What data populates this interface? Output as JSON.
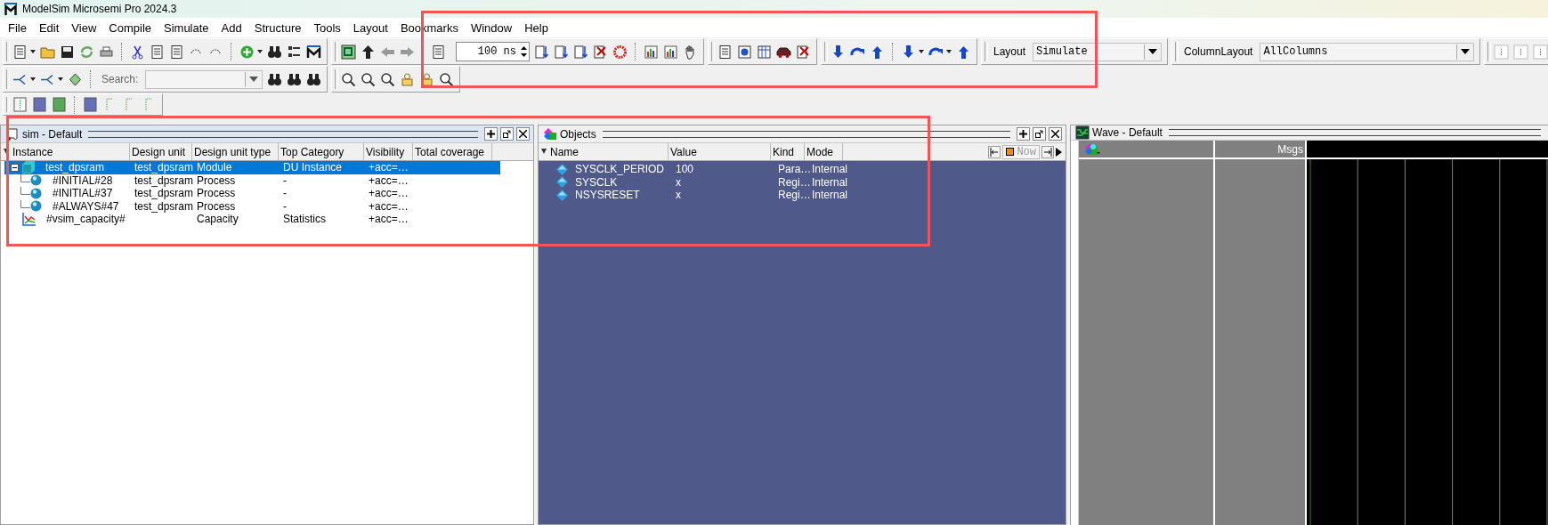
{
  "window": {
    "title": "ModelSim Microsemi Pro 2024.3"
  },
  "menu": [
    {
      "label": "File"
    },
    {
      "label": "Edit"
    },
    {
      "label": "View"
    },
    {
      "label": "Compile"
    },
    {
      "label": "Simulate"
    },
    {
      "label": "Add"
    },
    {
      "label": "Structure"
    },
    {
      "label": "Tools"
    },
    {
      "label": "Layout"
    },
    {
      "label": "Bookmarks"
    },
    {
      "label": "Window"
    },
    {
      "label": "Help"
    }
  ],
  "toolbar": {
    "run_length": "100 ns",
    "search_label": "Search:",
    "layout_label": "Layout",
    "layout": "Simulate",
    "column_layout_label": "ColumnLayout",
    "column_layout": "AllColumns"
  },
  "sim_panel": {
    "title": "sim - Default",
    "columns": [
      "Instance",
      "Design unit",
      "Design unit type",
      "Top Category",
      "Visibility",
      "Total coverage"
    ],
    "rows": [
      {
        "kind": "instance",
        "selected": true,
        "expanded": true,
        "cells": [
          "test_dpsram",
          "test_dpsram",
          "Module",
          "DU Instance",
          "+acc=…",
          ""
        ],
        "children": [
          {
            "kind": "process",
            "selected": false,
            "cells": [
              "#INITIAL#28",
              "test_dpsram",
              "Process",
              "-",
              "+acc=…",
              ""
            ]
          },
          {
            "kind": "process",
            "selected": false,
            "cells": [
              "#INITIAL#37",
              "test_dpsram",
              "Process",
              "-",
              "+acc=…",
              ""
            ]
          },
          {
            "kind": "process",
            "selected": false,
            "cells": [
              "#ALWAYS#47",
              "test_dpsram",
              "Process",
              "-",
              "+acc=…",
              ""
            ]
          }
        ]
      },
      {
        "kind": "statistics",
        "selected": false,
        "cells": [
          "#vsim_capacity#",
          "",
          "Capacity",
          "Statistics",
          "+acc=…",
          ""
        ]
      }
    ]
  },
  "objects_panel": {
    "title": "Objects",
    "columns": [
      "Name",
      "Value",
      "Kind",
      "Mode"
    ],
    "now_label": "Now",
    "rows": [
      {
        "cells": [
          "SYSCLK_PERIOD",
          "100",
          "Para…",
          "Internal"
        ]
      },
      {
        "cells": [
          "SYSCLK",
          "x",
          "Regi…",
          "Internal"
        ]
      },
      {
        "cells": [
          "NSYSRESET",
          "x",
          "Regi…",
          "Internal"
        ]
      }
    ]
  },
  "wave_panel": {
    "title": "Wave - Default",
    "msgs_label": "Msgs"
  }
}
